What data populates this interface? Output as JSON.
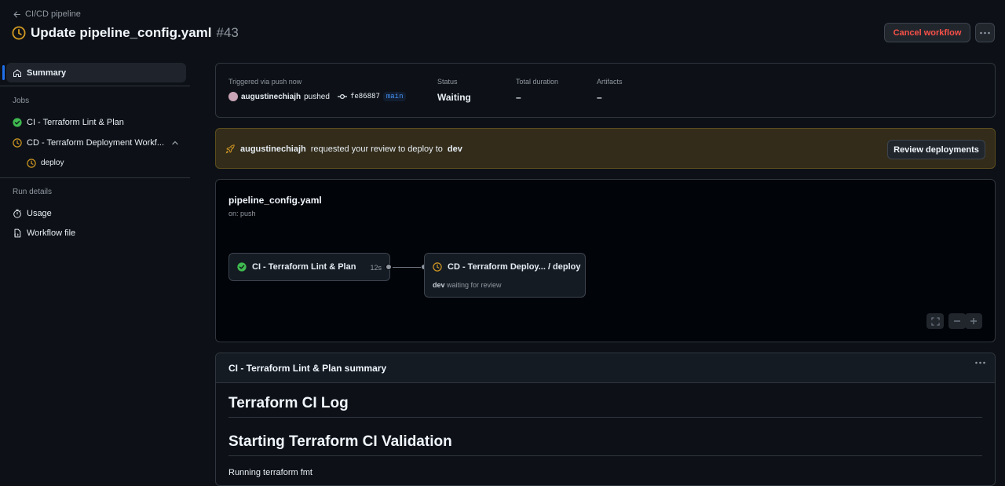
{
  "header": {
    "back_label": "CI/CD pipeline",
    "title": "Update pipeline_config.yaml",
    "run_number": "#43",
    "cancel_label": "Cancel workflow",
    "status_icon": "clock-icon"
  },
  "sidebar": {
    "summary_label": "Summary",
    "jobs_heading": "Jobs",
    "jobs": [
      {
        "label": "CI - Terraform Lint & Plan",
        "status": "success"
      },
      {
        "label": "CD - Terraform Deployment Workf...",
        "status": "waiting"
      }
    ],
    "sub_job_label": "deploy",
    "run_details_heading": "Run details",
    "usage_label": "Usage",
    "workflow_file_label": "Workflow file"
  },
  "info": {
    "triggered_label": "Triggered via push now",
    "user": "augustinechiajh",
    "pushed_text": "pushed",
    "sha": "fe86887",
    "branch": "main",
    "status_label": "Status",
    "status_value": "Waiting",
    "duration_label": "Total duration",
    "duration_value": "–",
    "artifacts_label": "Artifacts",
    "artifacts_value": "–"
  },
  "review": {
    "user": "augustinechiajh",
    "text": "requested your review to deploy to",
    "env": "dev",
    "button_label": "Review deployments"
  },
  "graph": {
    "file": "pipeline_config.yaml",
    "trigger": "on: push",
    "node1_label": "CI - Terraform Lint & Plan",
    "node1_duration": "12s",
    "node2_label": "CD - Terraform Deploy... / deploy",
    "node2_env": "dev",
    "node2_sub": "waiting for review"
  },
  "summary": {
    "title": "CI - Terraform Lint & Plan summary",
    "h1": "Terraform CI Log",
    "h2": "Starting Terraform CI Validation",
    "para": "Running terraform fmt"
  },
  "colors": {
    "background": "#0d1117",
    "success": "#3fb950",
    "waiting": "#d29922",
    "danger": "#f85149",
    "accent": "#1f6feb"
  }
}
